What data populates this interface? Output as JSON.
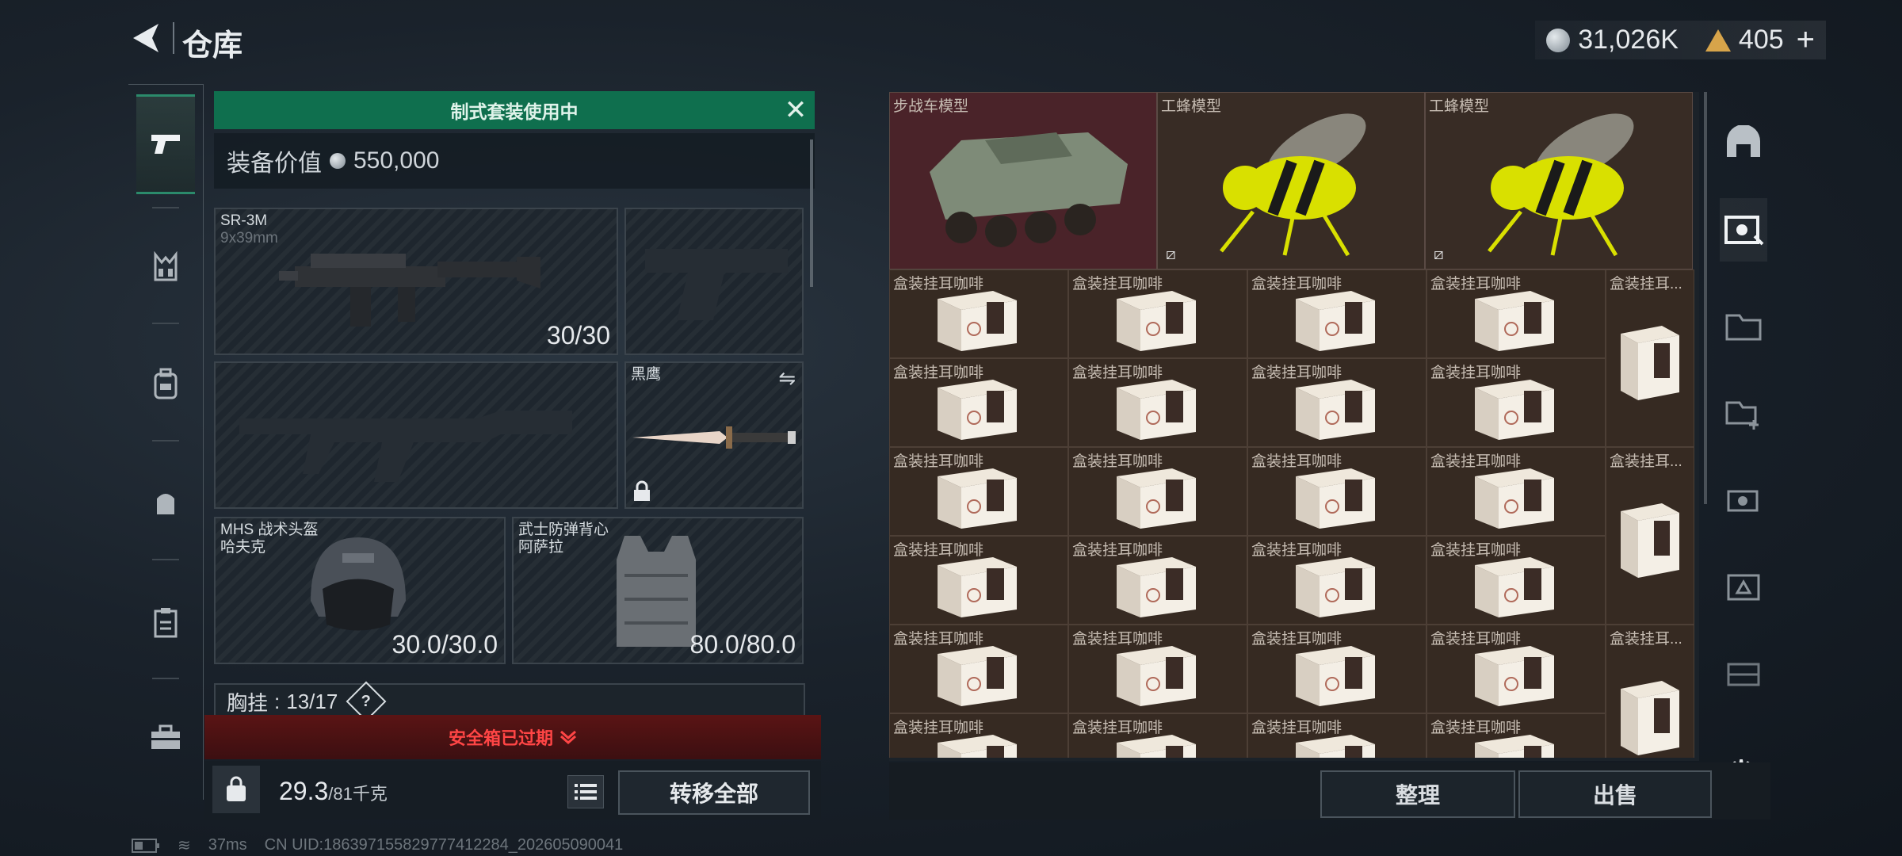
{
  "header": {
    "title": "仓库",
    "currency_silver": "31,026K",
    "currency_gold": "405"
  },
  "loadout": {
    "kit_banner": "制式套装使用中",
    "equip_value_label": "装备价值",
    "equip_value": "550,000",
    "primary_weapon": {
      "name": "SR-3M",
      "caliber": "9x39mm",
      "ammo": "30/30"
    },
    "knife": {
      "name": "黑鹰"
    },
    "helmet": {
      "name": "MHS 战术头盔",
      "sub": "哈夫克",
      "durability": "30.0/30.0"
    },
    "armor": {
      "name": "武士防弹背心",
      "sub": "阿萨拉",
      "durability": "80.0/80.0"
    },
    "chest_rig": {
      "label": "胸挂",
      "value": "13/17",
      "help": "?"
    },
    "safe_box_status": "安全箱已过期",
    "weight_value": "29.3",
    "weight_max": "/81千克",
    "transfer_all": "转移全部"
  },
  "status_bar": {
    "ping": "37ms",
    "uid": "CN UID:1863971558297774122​84_202605090041"
  },
  "storage": {
    "big_items": [
      {
        "label": "步战车模型"
      },
      {
        "label": "工蜂模型"
      },
      {
        "label": "工蜂模型"
      }
    ],
    "box_label": "盒装挂耳咖啡",
    "tall_label": "盒装挂耳..."
  },
  "actions": {
    "sort": "整理",
    "sell": "出售"
  }
}
